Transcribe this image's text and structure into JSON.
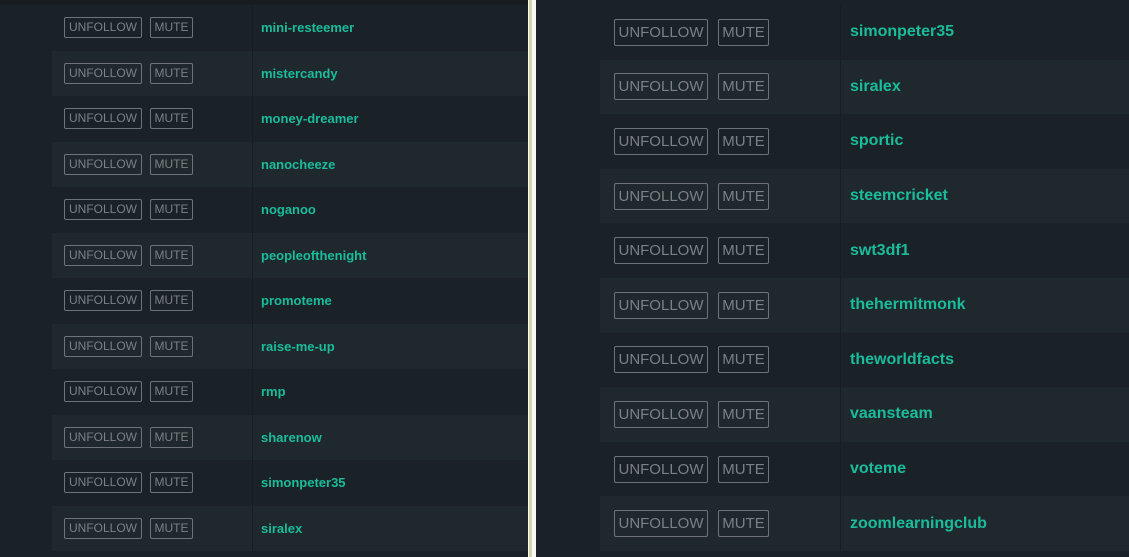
{
  "buttons": {
    "unfollow": "UNFOLLOW",
    "mute": "MUTE"
  },
  "left_panel": {
    "users": [
      "mini-resteemer",
      "mistercandy",
      "money-dreamer",
      "nanocheeze",
      "noganoo",
      "peopleofthenight",
      "promoteme",
      "raise-me-up",
      "rmp",
      "sharenow",
      "simonpeter35",
      "siralex"
    ]
  },
  "right_panel": {
    "users": [
      "simonpeter35",
      "siralex",
      "sportic",
      "steemcricket",
      "swt3df1",
      "thehermitmonk",
      "theworldfacts",
      "vaansteam",
      "voteme",
      "zoomlearningclub"
    ]
  },
  "colors": {
    "background": "#1b2227",
    "row_alt": "#1f292d",
    "username": "#1abc9c",
    "button_border": "#6d7377",
    "divider": "#f7f7f7"
  }
}
